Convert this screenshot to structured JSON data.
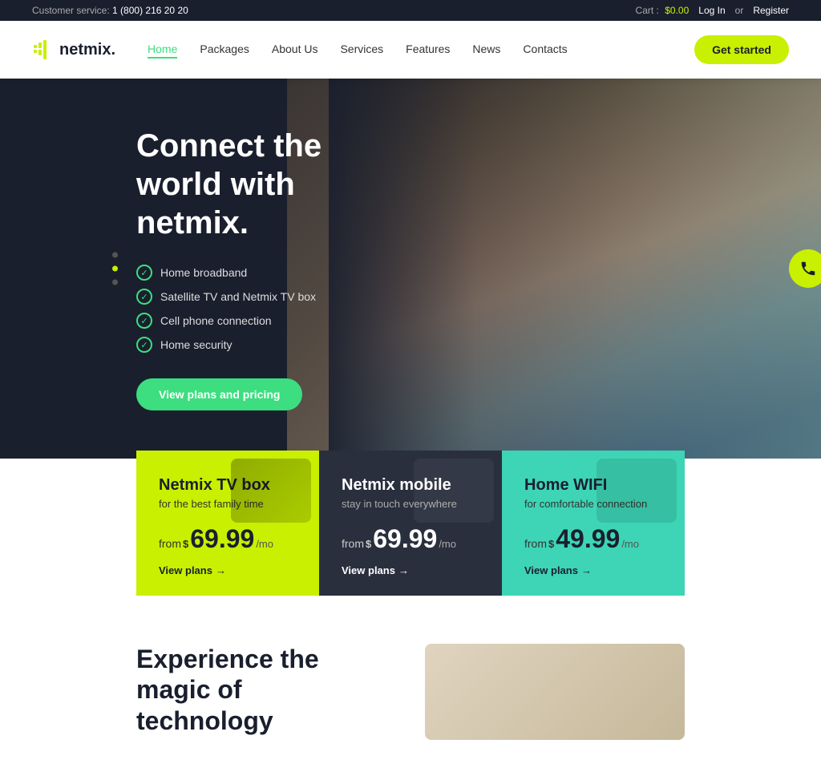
{
  "topbar": {
    "customer_service_label": "Customer service:",
    "phone": "1 (800) 216 20 20",
    "cart_label": "Cart :",
    "cart_amount": "$0.00",
    "login_label": "Log In",
    "or_text": "or",
    "register_label": "Register"
  },
  "navbar": {
    "logo_text": "netmix.",
    "nav_items": [
      {
        "label": "Home",
        "active": true
      },
      {
        "label": "Packages",
        "active": false
      },
      {
        "label": "About Us",
        "active": false
      },
      {
        "label": "Services",
        "active": false
      },
      {
        "label": "Features",
        "active": false
      },
      {
        "label": "News",
        "active": false
      },
      {
        "label": "Contacts",
        "active": false
      }
    ],
    "cta_label": "Get started"
  },
  "hero": {
    "title": "Connect the world with netmix.",
    "features": [
      "Home broadband",
      "Satellite TV and Netmix TV box",
      "Cell phone connection",
      "Home security"
    ],
    "cta_label": "View plans and pricing"
  },
  "cards": [
    {
      "id": "tv-box",
      "title": "Netmix TV box",
      "subtitle": "for the best family time",
      "price_from": "from",
      "price_dollar": "$",
      "price_amount": "69.99",
      "price_per": "/mo",
      "link_label": "View plans",
      "theme": "yellow"
    },
    {
      "id": "mobile",
      "title": "Netmix mobile",
      "subtitle": "stay in touch everywhere",
      "price_from": "from",
      "price_dollar": "$",
      "price_amount": "69.99",
      "price_per": "/mo",
      "link_label": "View plans",
      "theme": "dark"
    },
    {
      "id": "wifi",
      "title": "Home WIFI",
      "subtitle": "for comfortable connection",
      "price_from": "from",
      "price_dollar": "$",
      "price_amount": "49.99",
      "price_per": "/mo",
      "link_label": "View plans",
      "theme": "teal"
    }
  ],
  "bottom": {
    "title": "Experience the magic of technology"
  },
  "colors": {
    "accent_green": "#c8f000",
    "accent_teal": "#3cde7f",
    "dark_bg": "#1a1f2e"
  }
}
